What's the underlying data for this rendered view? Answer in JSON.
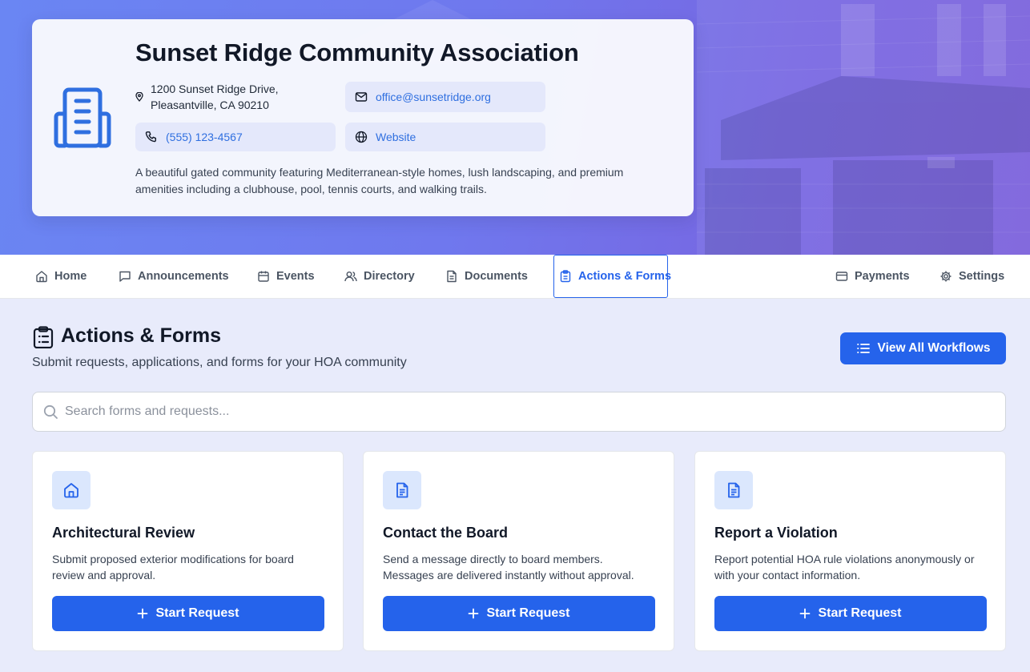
{
  "hero": {
    "org_name": "Sunset Ridge Community Association",
    "address_line1": "1200 Sunset Ridge Drive,",
    "address_line2": "Pleasantville, CA 90210",
    "email": "office@sunsetridge.org",
    "phone": "(555) 123-4567",
    "website_label": "Website",
    "description": "A beautiful gated community featuring Mediterranean-style homes, lush landscaping, and premium amenities including a clubhouse, pool, tennis courts, and walking trails."
  },
  "nav": {
    "items": [
      {
        "label": "Home",
        "icon": "home-icon"
      },
      {
        "label": "Announcements",
        "icon": "message-icon"
      },
      {
        "label": "Events",
        "icon": "calendar-icon"
      },
      {
        "label": "Directory",
        "icon": "users-icon"
      },
      {
        "label": "Documents",
        "icon": "document-icon"
      },
      {
        "label": "Actions & Forms",
        "icon": "clipboard-icon",
        "active": true
      },
      {
        "label": "Payments",
        "icon": "credit-card-icon"
      },
      {
        "label": "Settings",
        "icon": "gear-icon"
      }
    ]
  },
  "main": {
    "title": "Actions & Forms",
    "subtitle": "Submit requests, applications, and forms for your HOA community",
    "view_all_label": "View All Workflows",
    "search_placeholder": "Search forms and requests...",
    "cards": [
      {
        "title": "Architectural Review",
        "icon": "home-icon",
        "description": "Submit proposed exterior modifications for board review and approval.",
        "button_label": "Start Request"
      },
      {
        "title": "Contact the Board",
        "icon": "document-icon",
        "description": "Send a message directly to board members. Messages are delivered instantly without approval.",
        "button_label": "Start Request"
      },
      {
        "title": "Report a Violation",
        "icon": "document-icon",
        "description": "Report potential HOA rule violations anonymously or with your contact information.",
        "button_label": "Start Request"
      }
    ]
  },
  "colors": {
    "accent": "#2563eb",
    "hero_gradient_start": "#6a86f3",
    "hero_gradient_end": "#7a5fdb",
    "page_background": "#e8ebfb"
  }
}
